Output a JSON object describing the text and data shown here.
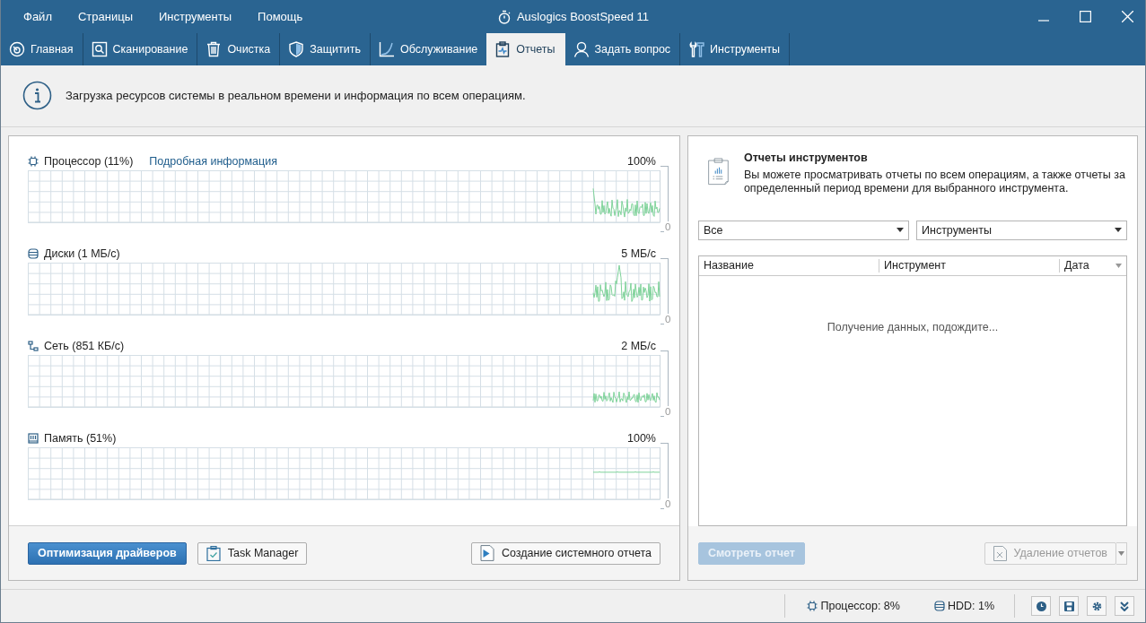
{
  "window": {
    "title": "Auslogics BoostSpeed 11"
  },
  "menu": [
    "Файл",
    "Страницы",
    "Инструменты",
    "Помощь"
  ],
  "tabs": [
    {
      "label": "Главная",
      "selected": false
    },
    {
      "label": "Сканирование",
      "selected": false
    },
    {
      "label": "Очистка",
      "selected": false
    },
    {
      "label": "Защитить",
      "selected": false
    },
    {
      "label": "Обслуживание",
      "selected": false
    },
    {
      "label": "Отчеты",
      "selected": true
    },
    {
      "label": "Задать вопрос",
      "selected": false
    },
    {
      "label": "Инструменты",
      "selected": false
    }
  ],
  "info": "Загрузка ресурсов системы в реальном времени и информация по всем операциям.",
  "monitors": [
    {
      "kind": "cpu",
      "label": "Процессор (11%)",
      "link": "Подробная информация",
      "max": "100%",
      "min": "0"
    },
    {
      "kind": "disk",
      "label": "Диски (1 МБ/с)",
      "max": "5 МБ/с",
      "min": "0"
    },
    {
      "kind": "network",
      "label": "Сеть (851 КБ/с)",
      "max": "2 МБ/с",
      "min": "0"
    },
    {
      "kind": "memory",
      "label": "Память (51%)",
      "max": "100%",
      "min": "0"
    }
  ],
  "left_buttons": [
    {
      "kind": "primary",
      "label": "Оптимизация драйверов"
    },
    {
      "kind": "task",
      "label": "Task Manager"
    },
    {
      "kind": "report",
      "label": "Создание системного отчета"
    }
  ],
  "reports": {
    "title": "Отчеты инструментов",
    "description": "Вы можете просматривать отчеты по всем операциям, а также отчеты за определенный период времени для выбранного инструмента.",
    "filters": [
      "Все",
      "Инструменты"
    ],
    "columns": [
      "Название",
      "Инструмент",
      "Дата"
    ],
    "empty_message": "Получение данных, подождите...",
    "view_button": {
      "label": "Смотреть отчет",
      "disabled": true
    },
    "delete_button": {
      "label": "Удаление отчетов",
      "disabled": true
    }
  },
  "status_bar": [
    {
      "kind": "cpu",
      "text": "Процессор: 8%"
    },
    {
      "kind": "disk",
      "text": "HDD: 1%"
    }
  ]
}
